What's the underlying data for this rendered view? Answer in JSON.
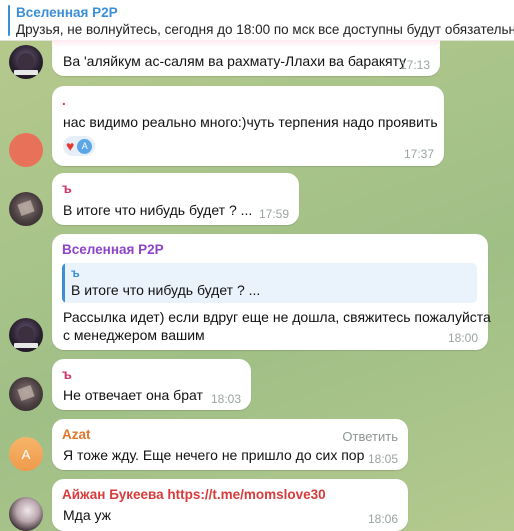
{
  "pinned": {
    "title": "Вселенная P2P",
    "text": "Друзья, не волнуйтесь, сегодня до 18:00 по мск все доступны будут обязательн"
  },
  "messages": [
    {
      "name": "",
      "text": "Ва 'аляйкум ас-салям ва рахмату-Ллахи ва баракяту",
      "time": "17:13"
    },
    {
      "name": ".",
      "text": "нас видимо реально много:)чуть терпения надо проявить",
      "time": "17:37",
      "reaction_user_initial": "A"
    },
    {
      "name": "ъ",
      "text": "В итоге что нибудь будет ? ...",
      "time": "17:59"
    },
    {
      "name": "Вселенная P2P",
      "quote_name": "ъ",
      "quote_text": "В итоге что нибудь будет ? ...",
      "text_line1": "Рассылка идет) если вдруг еще не дошла, свяжитесь пожалуйста",
      "text_line2": "с менеджером вашим",
      "time": "18:00"
    },
    {
      "name": "ъ",
      "text": "Не отвечает она брат",
      "time": "18:03"
    },
    {
      "name": "Azat",
      "avatar_initial": "A",
      "reply_label": "Ответить",
      "text": "Я тоже жду. Еще нечего не пришло до сих пор",
      "time": "18:05"
    },
    {
      "name": "Айжан Букеева https://t.me/momslove30",
      "text": "Мда уж",
      "time": "18:06"
    }
  ],
  "colors": {
    "accent": "#3a8fd6",
    "name_purple": "#8e44c9",
    "name_orange": "#e0762a",
    "name_red": "#d83b3b",
    "name_pink": "#d2336b"
  }
}
